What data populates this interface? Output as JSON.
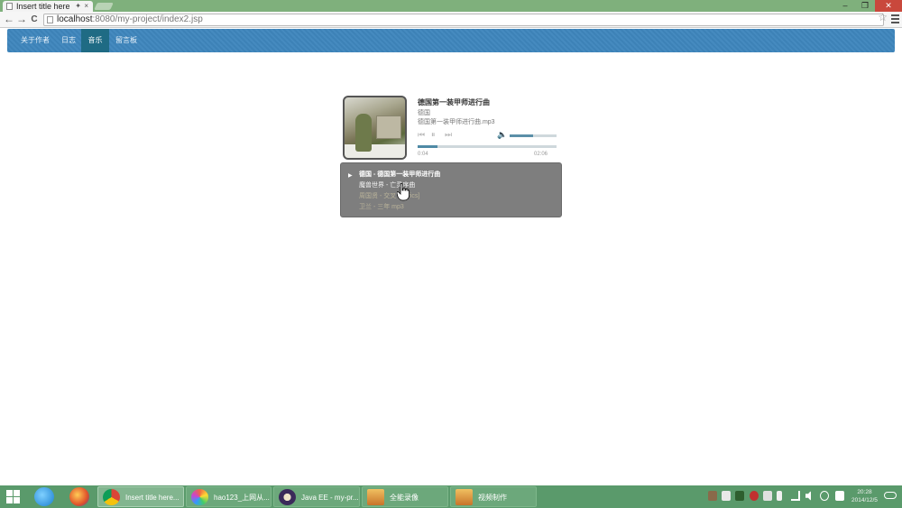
{
  "browser": {
    "tab_title": "Insert title here",
    "tab_close": "×",
    "tab_pin": "✦",
    "url_host": "localhost",
    "url_rest": ":8080/my-project/index2.jsp",
    "back_icon": "←",
    "forward_icon": "→",
    "reload_icon": "C",
    "star_icon": "☆",
    "window_min": "–",
    "window_max": "❐",
    "window_close": "✕"
  },
  "nav": {
    "items": [
      {
        "label": "关于作者",
        "active": false
      },
      {
        "label": "日志",
        "active": false
      },
      {
        "label": "音乐",
        "active": true
      },
      {
        "label": "留言板",
        "active": false
      }
    ]
  },
  "player": {
    "title": "德国第一装甲师进行曲",
    "artist": "德国",
    "file": "德国第一装甲师进行曲.mp3",
    "prev_icon": "⏮",
    "play_icon": "⏸",
    "next_icon": "⏭",
    "volume_icon": "🔈",
    "volume": 0.5,
    "progress": 0.14,
    "time_current": "0:04",
    "time_total": "02:06"
  },
  "playlist": {
    "items": [
      {
        "text": "德国 - 德国第一装甲师进行曲",
        "state": "current"
      },
      {
        "text": "魔兽世界 - 亡灵序曲",
        "state": "played"
      },
      {
        "text": "周国贤 - 交叉 - [lyrics]",
        "state": "dim"
      },
      {
        "text": "卫兰 - 三年 mp3",
        "state": "dim"
      }
    ]
  },
  "taskbar": {
    "tasks": [
      {
        "label": "Insert title here...",
        "state": "active",
        "icon": "chrome-icon",
        "color": "#e04a3c"
      },
      {
        "label": "hao123_上网从...",
        "state": "normal",
        "icon": "hao123-icon",
        "color": "#e0a020"
      },
      {
        "label": "Java EE - my-pr...",
        "state": "normal",
        "icon": "eclipse-icon",
        "color": "#3b2a5a"
      },
      {
        "label": "全能录像",
        "state": "normal",
        "icon": "recorder-icon",
        "color": "#c8742a"
      },
      {
        "label": "视频制作",
        "state": "normal",
        "icon": "video-maker-icon",
        "color": "#c8742a"
      }
    ],
    "time": "20:28",
    "date": "2014/12/5"
  },
  "colors": {
    "nav_bg": "#3f86bd",
    "nav_active": "#1f6b84",
    "taskbar": "#5a9a6b",
    "tabstrip": "#7fb07c"
  }
}
